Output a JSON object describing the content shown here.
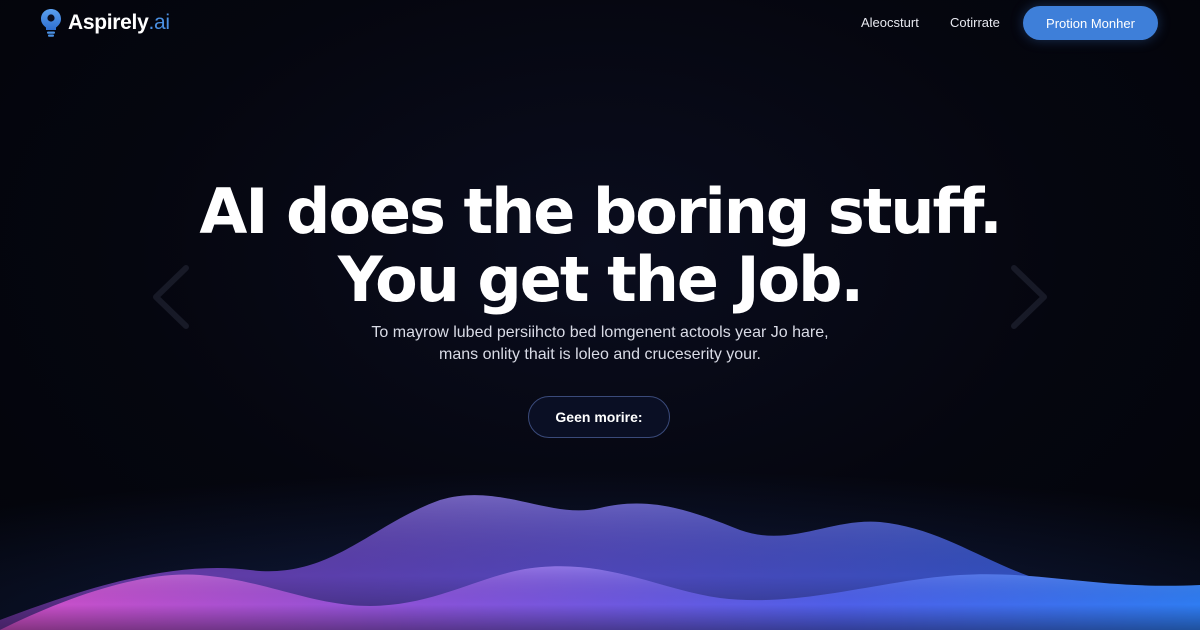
{
  "brand": {
    "name": "Aspirely",
    "tld": ".ai",
    "accent": "#4a90e2"
  },
  "nav": {
    "links": [
      "Aleocsturt",
      "Cotirrate"
    ],
    "cta_label": "Protion Monher",
    "cta_color": "#3e7fd9"
  },
  "hero": {
    "headline_line1": "AI does the boring stuff.",
    "headline_line2": "You get the Job.",
    "sub_line1": "To mayrow lubed persiihcto bed lomgenent actools year Jo hare,",
    "sub_line2": "mans onlity thait is loleo and cruceserity your.",
    "cta_label": "Geen morire:"
  },
  "icons": {
    "logo": "lightbulb-pin-icon",
    "prev": "chevron-left-icon",
    "next": "chevron-right-icon"
  },
  "colors": {
    "background": "#05060f",
    "wave_pink": "#c050d0",
    "wave_blue": "#3a6cf0"
  }
}
